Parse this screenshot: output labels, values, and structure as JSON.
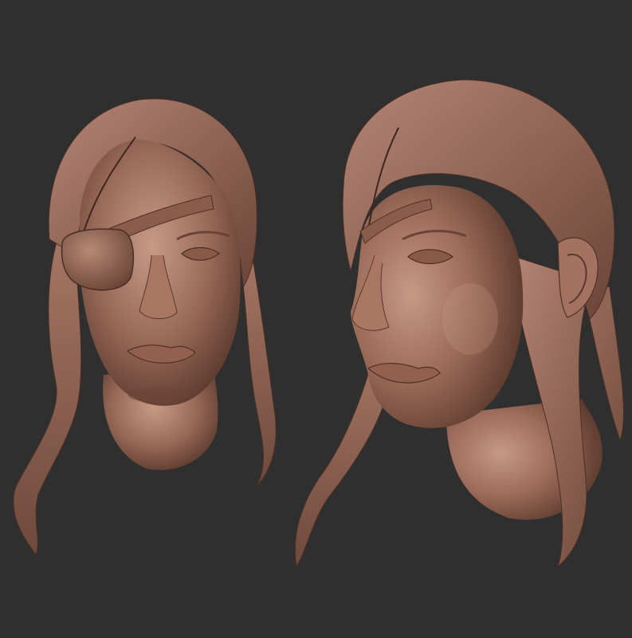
{
  "scene": {
    "background_color": "#2f2f2f",
    "clay_color": "#9a6a58",
    "clay_shadow": "#5a3a2e",
    "clay_highlight": "#c89a86",
    "subjects": [
      {
        "kind": "sculpted-head",
        "view": "front",
        "accessory": "eye-patch"
      },
      {
        "kind": "sculpted-head",
        "view": "three-quarter"
      }
    ]
  }
}
